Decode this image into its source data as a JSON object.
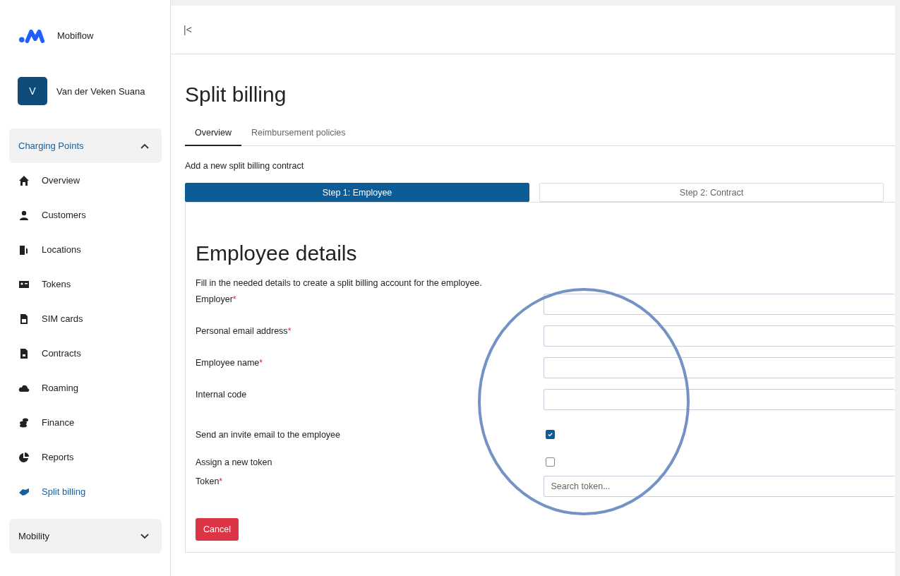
{
  "sidebar": {
    "brand": "Mobiflow",
    "user": {
      "initial": "V",
      "name": "Van der Veken Suana"
    },
    "groups": [
      {
        "label": "Charging Points",
        "expanded": true,
        "items": [
          {
            "label": "Overview",
            "selected": false
          },
          {
            "label": "Customers",
            "selected": false
          },
          {
            "label": "Locations",
            "selected": false
          },
          {
            "label": "Tokens",
            "selected": false
          },
          {
            "label": "SIM cards",
            "selected": false
          },
          {
            "label": "Contracts",
            "selected": false
          },
          {
            "label": "Roaming",
            "selected": false
          },
          {
            "label": "Finance",
            "selected": false
          },
          {
            "label": "Reports",
            "selected": false
          },
          {
            "label": "Split billing",
            "selected": true
          }
        ]
      },
      {
        "label": "Mobility",
        "expanded": false
      }
    ]
  },
  "topbar": {
    "collapse_glyph": "|<"
  },
  "page": {
    "title": "Split billing",
    "tabs": [
      {
        "label": "Overview",
        "selected": true
      },
      {
        "label": "Reimbursement policies",
        "selected": false
      }
    ],
    "subtitle": "Add a new split billing contract",
    "steps": [
      {
        "label": "Step 1: Employee",
        "selected": true
      },
      {
        "label": "Step 2: Contract",
        "selected": false
      }
    ],
    "form": {
      "title": "Employee details",
      "intro": "Fill in the needed details to create a split billing account for the employee.",
      "fields": [
        {
          "kind": "text",
          "label": "Employer",
          "required_mark": "*"
        },
        {
          "kind": "text",
          "label": "Personal email address",
          "required_mark": "*"
        },
        {
          "kind": "text",
          "label": "Employee name",
          "required_mark": "*"
        },
        {
          "kind": "text",
          "label": "Internal code"
        },
        {
          "kind": "checkbox",
          "label": "Send an invite email to the employee",
          "checked": true
        },
        {
          "kind": "checkbox",
          "label": "Assign a new token",
          "checked": false
        },
        {
          "kind": "search",
          "label": "Token",
          "required_mark": "*",
          "placeholder": "Search token..."
        }
      ],
      "cancel": "Cancel"
    }
  }
}
